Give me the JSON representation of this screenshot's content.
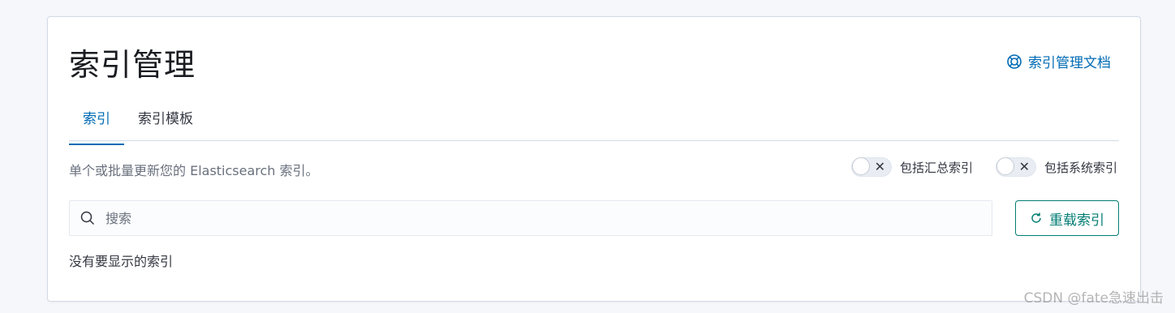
{
  "header": {
    "title": "索引管理",
    "doc_link_label": "索引管理文档"
  },
  "tabs": [
    {
      "label": "索引"
    },
    {
      "label": "索引模板"
    }
  ],
  "description": "单个或批量更新您的 Elasticsearch 索引。",
  "toggles": [
    {
      "label": "包括汇总索引",
      "x_symbol": "✕",
      "checked": false
    },
    {
      "label": "包括系统索引",
      "x_symbol": "✕",
      "checked": false
    }
  ],
  "search": {
    "placeholder": "搜索",
    "value": ""
  },
  "reload_button": {
    "label": "重载索引"
  },
  "empty_message": "没有要显示的索引",
  "watermark": "CSDN @fate急速出击",
  "colors": {
    "accent": "#006bb4",
    "reload": "#017d73",
    "text": "#343741",
    "muted": "#69707d"
  }
}
